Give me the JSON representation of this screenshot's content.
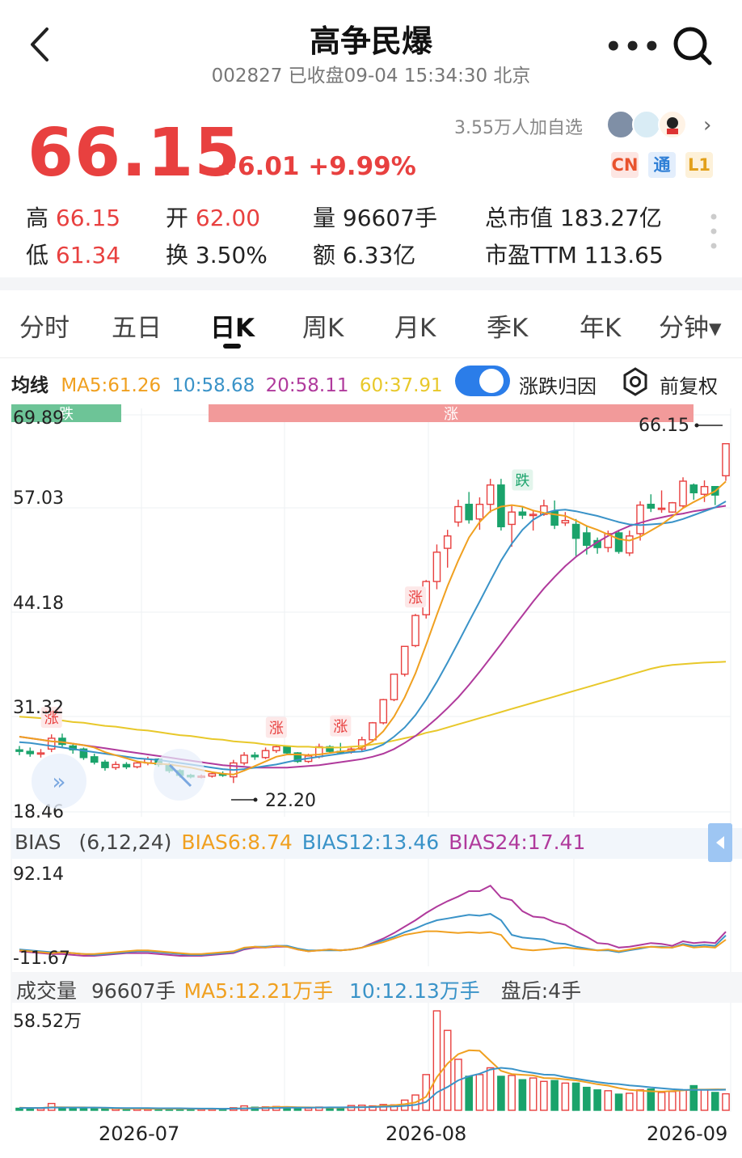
{
  "header": {
    "back_icon": "chevron-left-icon",
    "title": "高争民爆",
    "subtitle": "002827 已收盘09-04 15:34:30 北京",
    "more_icon": "more-dots-icon",
    "search_icon": "search-icon"
  },
  "quote": {
    "price": "66.15",
    "change": "+6.01 +9.99%",
    "followers": "3.55万人加自选",
    "tags": [
      "CN",
      "通",
      "L1"
    ],
    "stats": [
      {
        "label": "高",
        "value": "66.15",
        "red": true
      },
      {
        "label": "开",
        "value": "62.00",
        "red": true
      },
      {
        "label": "量",
        "value": "96607手",
        "red": false
      },
      {
        "label": "总市值",
        "value": "183.27亿",
        "red": false
      },
      {
        "label": "低",
        "value": "61.34",
        "red": true
      },
      {
        "label": "换",
        "value": "3.50%",
        "red": false
      },
      {
        "label": "额",
        "value": "6.33亿",
        "red": false
      },
      {
        "label": "市盈TTM",
        "value": "113.65",
        "red": false
      }
    ]
  },
  "tabs": [
    "分时",
    "五日",
    "日K",
    "周K",
    "月K",
    "季K",
    "年K",
    "分钟▾"
  ],
  "active_tab": "日K",
  "ma_legend": {
    "label": "均线",
    "ma5": "MA5:61.26",
    "ma10": "10:58.68",
    "ma20": "20:58.11",
    "ma60": "60:37.91",
    "toggle_label": "涨跌归因",
    "adjust_label": "前复权"
  },
  "colors": {
    "up": "#e8403f",
    "down": "#1aa36b",
    "ma5": "#f0a020",
    "ma10": "#3a93c8",
    "ma20": "#b03a9c",
    "ma60": "#e8c82a",
    "accent": "#2b7de9"
  },
  "bias_legend": {
    "label": "BIAS",
    "params": "(6,12,24)",
    "b6": "BIAS6:8.74",
    "b12": "BIAS12:13.46",
    "b24": "BIAS24:17.41"
  },
  "volume_legend": {
    "label": "成交量",
    "vol": "96607手",
    "ma5": "MA5:12.21万手",
    "ma10": "10:12.13万手",
    "after_hours": "盘后:4手"
  },
  "dates": [
    "2026-07",
    "2026-08",
    "2026-09"
  ],
  "chart_data": {
    "type": "candlestick",
    "y_ticks": [
      "69.89",
      "57.03",
      "44.18",
      "31.32",
      "18.46"
    ],
    "ylim": [
      18.46,
      69.89
    ],
    "high_marker": "66.15",
    "low_marker": "22.20",
    "event_bands": [
      "跌",
      "涨"
    ],
    "event_labels": [
      "涨",
      "涨",
      "涨",
      "涨",
      "跌"
    ],
    "candles": [
      [
        26.5,
        26.3,
        27.0,
        25.8
      ],
      [
        26.3,
        26.0,
        26.8,
        25.6
      ],
      [
        26.0,
        26.1,
        26.6,
        25.5
      ],
      [
        26.6,
        28.0,
        28.5,
        26.2
      ],
      [
        28.0,
        27.2,
        28.6,
        26.9
      ],
      [
        27.0,
        26.5,
        27.3,
        26.0
      ],
      [
        26.6,
        25.5,
        26.8,
        25.2
      ],
      [
        25.6,
        24.9,
        26.0,
        24.6
      ],
      [
        24.9,
        24.2,
        25.2,
        23.8
      ],
      [
        24.2,
        24.6,
        25.0,
        23.9
      ],
      [
        24.6,
        24.3,
        24.9,
        24.0
      ],
      [
        24.3,
        24.8,
        25.1,
        24.1
      ],
      [
        24.8,
        25.3,
        25.6,
        24.5
      ],
      [
        25.3,
        24.6,
        25.4,
        24.3
      ],
      [
        24.6,
        23.8,
        24.8,
        23.5
      ],
      [
        23.8,
        23.2,
        24.0,
        22.9
      ],
      [
        23.2,
        23.0,
        23.4,
        22.8
      ],
      [
        23.0,
        23.1,
        23.3,
        22.8
      ],
      [
        23.1,
        23.4,
        23.6,
        22.9
      ],
      [
        23.4,
        23.2,
        23.7,
        23.0
      ],
      [
        23.0,
        24.8,
        25.2,
        22.2
      ],
      [
        24.8,
        25.8,
        26.2,
        24.5
      ],
      [
        25.8,
        25.6,
        26.2,
        25.2
      ],
      [
        25.5,
        26.4,
        26.8,
        25.3
      ],
      [
        26.4,
        26.9,
        27.2,
        26.1
      ],
      [
        26.9,
        26.1,
        27.0,
        25.8
      ],
      [
        26.1,
        25.0,
        26.2,
        24.8
      ],
      [
        25.0,
        25.7,
        26.0,
        24.8
      ],
      [
        25.6,
        26.9,
        27.3,
        25.4
      ],
      [
        26.9,
        26.3,
        27.1,
        26.0
      ],
      [
        26.3,
        26.2,
        27.4,
        26.0
      ],
      [
        26.3,
        26.6,
        27.0,
        26.0
      ],
      [
        26.6,
        27.8,
        28.2,
        26.3
      ],
      [
        27.8,
        30.0,
        30.1,
        27.5
      ],
      [
        30.0,
        33.0,
        33.1,
        29.8
      ],
      [
        33.0,
        36.3,
        36.3,
        32.8
      ],
      [
        36.3,
        39.9,
        39.9,
        36.0
      ],
      [
        40.0,
        43.9,
        44.1,
        39.8
      ],
      [
        44.0,
        48.3,
        48.5,
        43.5
      ],
      [
        48.3,
        52.1,
        53.1,
        47.3
      ],
      [
        52.6,
        54.2,
        55.0,
        50.1
      ],
      [
        56.0,
        58.0,
        58.9,
        55.4
      ],
      [
        58.3,
        56.3,
        59.9,
        55.8
      ],
      [
        56.4,
        58.3,
        59.2,
        55.0
      ],
      [
        58.3,
        60.8,
        61.6,
        57.2
      ],
      [
        60.8,
        55.4,
        61.6,
        54.9
      ],
      [
        55.7,
        57.3,
        58.1,
        52.8
      ],
      [
        57.3,
        56.9,
        58.0,
        56.4
      ],
      [
        56.9,
        57.0,
        57.6,
        54.9
      ],
      [
        57.0,
        58.1,
        58.9,
        56.8
      ],
      [
        57.4,
        55.6,
        58.8,
        55.1
      ],
      [
        55.9,
        56.2,
        57.3,
        55.5
      ],
      [
        55.7,
        53.9,
        56.4,
        51.6
      ],
      [
        54.6,
        53.0,
        55.4,
        51.8
      ],
      [
        53.6,
        52.7,
        54.0,
        51.9
      ],
      [
        52.7,
        54.5,
        54.9,
        52.1
      ],
      [
        54.6,
        52.2,
        55.0,
        51.9
      ],
      [
        52.0,
        54.2,
        54.9,
        51.6
      ],
      [
        54.5,
        58.2,
        58.7,
        53.6
      ],
      [
        58.3,
        57.8,
        59.6,
        57.3
      ],
      [
        57.8,
        57.8,
        60.1,
        57.2
      ],
      [
        57.3,
        58.5,
        58.6,
        57.2
      ],
      [
        58.1,
        61.3,
        61.8,
        57.8
      ],
      [
        60.8,
        59.8,
        61.0,
        58.9
      ],
      [
        59.6,
        60.6,
        61.4,
        58.6
      ],
      [
        60.6,
        59.5,
        60.6,
        58.2
      ],
      [
        62.0,
        66.15,
        66.15,
        61.34
      ]
    ],
    "ma5": [
      28.2,
      28.0,
      27.8,
      27.6,
      27.5,
      27.3,
      27.1,
      26.8,
      26.2,
      25.8,
      25.4,
      25.0,
      24.8,
      24.7,
      24.6,
      24.4,
      24.2,
      23.9,
      23.6,
      23.4,
      23.3,
      23.8,
      24.4,
      25.0,
      25.6,
      25.9,
      25.9,
      25.8,
      25.9,
      26.1,
      26.3,
      26.4,
      26.8,
      27.6,
      28.9,
      30.8,
      33.3,
      36.4,
      40.1,
      44.0,
      47.7,
      51.0,
      54.0,
      56.0,
      57.4,
      58.0,
      58.2,
      58.0,
      57.5,
      57.2,
      57.0,
      56.8,
      56.2,
      55.5,
      55.0,
      54.4,
      53.8,
      53.6,
      54.1,
      54.9,
      55.7,
      56.7,
      57.8,
      58.6,
      59.3,
      60.0,
      61.26
    ],
    "ma10": [
      27.5,
      27.4,
      27.2,
      27.0,
      26.8,
      26.6,
      26.4,
      26.2,
      26.0,
      25.8,
      25.6,
      25.4,
      25.3,
      25.2,
      25.0,
      24.8,
      24.6,
      24.4,
      24.2,
      24.0,
      23.9,
      24.0,
      24.2,
      24.4,
      24.6,
      24.9,
      25.2,
      25.4,
      25.6,
      25.8,
      26.0,
      26.2,
      26.3,
      26.6,
      27.2,
      28.2,
      29.4,
      31.0,
      33.0,
      35.3,
      37.8,
      40.4,
      43.1,
      45.7,
      48.4,
      51.0,
      53.2,
      55.0,
      56.3,
      57.1,
      57.5,
      57.6,
      57.4,
      57.1,
      56.8,
      56.4,
      56.0,
      55.7,
      55.6,
      55.7,
      55.8,
      56.0,
      56.4,
      56.9,
      57.4,
      57.9,
      58.68
    ],
    "ma20": [
      28.2,
      28.0,
      27.8,
      27.6,
      27.5,
      27.3,
      27.1,
      26.9,
      26.7,
      26.5,
      26.3,
      26.1,
      25.9,
      25.7,
      25.5,
      25.3,
      25.1,
      24.9,
      24.7,
      24.5,
      24.4,
      24.3,
      24.2,
      24.2,
      24.2,
      24.2,
      24.3,
      24.4,
      24.5,
      24.7,
      24.9,
      25.1,
      25.3,
      25.6,
      26.0,
      26.6,
      27.4,
      28.3,
      29.4,
      30.6,
      31.9,
      33.3,
      34.9,
      36.6,
      38.4,
      40.2,
      42.1,
      43.9,
      45.7,
      47.4,
      48.9,
      50.3,
      51.5,
      52.5,
      53.4,
      54.2,
      54.9,
      55.5,
      55.9,
      56.3,
      56.6,
      56.9,
      57.1,
      57.4,
      57.6,
      57.9,
      58.11
    ],
    "ma60": [
      30.8,
      30.7,
      30.6,
      30.5,
      30.3,
      30.1,
      30.0,
      29.8,
      29.6,
      29.5,
      29.3,
      29.1,
      29.0,
      28.8,
      28.6,
      28.4,
      28.3,
      28.1,
      27.9,
      27.8,
      27.6,
      27.5,
      27.4,
      27.2,
      27.1,
      27.0,
      26.9,
      26.9,
      26.8,
      26.8,
      26.8,
      26.9,
      27.0,
      27.2,
      27.4,
      27.7,
      28.0,
      28.3,
      28.7,
      29.0,
      29.4,
      29.8,
      30.2,
      30.6,
      31.0,
      31.4,
      31.8,
      32.2,
      32.6,
      33.0,
      33.4,
      33.8,
      34.2,
      34.6,
      35.0,
      35.4,
      35.8,
      36.2,
      36.6,
      37.0,
      37.3,
      37.5,
      37.6,
      37.7,
      37.8,
      37.85,
      37.91
    ],
    "bias": {
      "ylim": [
        -11.67,
        92.14
      ],
      "y_ticks": [
        "92.14",
        "-11.67"
      ],
      "bias6": [
        -3,
        -4,
        -5,
        -6,
        -5,
        -6,
        -7,
        -7,
        -6,
        -5,
        -4,
        -3,
        -3,
        -4,
        -5,
        -6,
        -7,
        -7,
        -6,
        -5,
        -4,
        0,
        1,
        0,
        2,
        1,
        -2,
        -4,
        -3,
        -2,
        -3,
        -2,
        0,
        3,
        6,
        10,
        14,
        16,
        18,
        18,
        17,
        16,
        17,
        16,
        17,
        14,
        0,
        -2,
        -3,
        -2,
        -1,
        0,
        -1,
        -2,
        -3,
        -2,
        -4,
        -2,
        0,
        1,
        0,
        0,
        3,
        0,
        1,
        0,
        8.74
      ],
      "bias12": [
        -2,
        -3,
        -4,
        -5,
        -5,
        -6,
        -7,
        -8,
        -7,
        -6,
        -5,
        -4,
        -4,
        -5,
        -6,
        -7,
        -8,
        -8,
        -7,
        -6,
        -5,
        -1,
        1,
        1,
        2,
        2,
        -1,
        -3,
        -3,
        -3,
        -3,
        -2,
        0,
        4,
        8,
        12,
        17,
        21,
        26,
        30,
        32,
        34,
        36,
        35,
        37,
        30,
        14,
        11,
        10,
        9,
        5,
        4,
        1,
        -1,
        -3,
        -3,
        -5,
        -3,
        -1,
        1,
        1,
        0,
        4,
        2,
        3,
        2,
        13.46
      ],
      "bias24": [
        -4,
        -5,
        -6,
        -7,
        -7,
        -8,
        -9,
        -9,
        -8,
        -7,
        -6,
        -6,
        -6,
        -7,
        -8,
        -9,
        -9,
        -9,
        -8,
        -7,
        -6,
        -2,
        0,
        0,
        1,
        1,
        -2,
        -4,
        -3,
        -2,
        -3,
        -2,
        0,
        5,
        10,
        16,
        23,
        30,
        38,
        45,
        51,
        56,
        62,
        62,
        68,
        55,
        52,
        40,
        34,
        33,
        28,
        25,
        18,
        12,
        5,
        4,
        0,
        1,
        3,
        5,
        4,
        2,
        7,
        5,
        6,
        5,
        17.41
      ]
    },
    "volume": {
      "ylim": [
        0,
        58.52
      ],
      "y_ticks": [
        "58.52万"
      ],
      "values": [
        1.2,
        1.0,
        1.1,
        4.0,
        1.5,
        1.2,
        1.3,
        1.0,
        0.9,
        1.0,
        0.8,
        1.1,
        1.0,
        0.9,
        0.8,
        0.9,
        0.8,
        0.8,
        1.0,
        0.9,
        1.5,
        2.6,
        1.8,
        2.0,
        2.2,
        1.5,
        1.3,
        1.2,
        1.9,
        1.4,
        1.3,
        2.8,
        3.0,
        2.6,
        3.4,
        3.2,
        6.0,
        9.0,
        21.0,
        58.5,
        47.0,
        30.0,
        20.0,
        21.0,
        25.0,
        20.0,
        20.5,
        18.0,
        19.0,
        17.0,
        17.5,
        16.0,
        16.0,
        13.5,
        12.0,
        11.5,
        9.5,
        10.0,
        12.0,
        12.5,
        10.5,
        11.0,
        12.0,
        14.5,
        12.0,
        10.5,
        9.7
      ],
      "ma5": [
        1.5,
        1.4,
        1.4,
        1.8,
        1.8,
        1.7,
        1.7,
        1.6,
        1.4,
        1.1,
        1.0,
        1.0,
        0.9,
        0.9,
        0.9,
        0.9,
        0.9,
        0.9,
        0.9,
        0.9,
        1.0,
        1.2,
        1.4,
        1.6,
        1.9,
        2.0,
        1.8,
        1.7,
        1.6,
        1.5,
        1.5,
        1.7,
        1.9,
        2.1,
        2.6,
        3.0,
        3.6,
        4.6,
        8.0,
        19.5,
        27.5,
        33.0,
        35.3,
        35.0,
        29.0,
        23.2,
        21.3,
        20.9,
        20.5,
        19.0,
        18.8,
        18.2,
        17.6,
        16.5,
        15.3,
        14.5,
        13.1,
        12.0,
        11.5,
        11.2,
        11.0,
        11.3,
        11.7,
        12.2,
        12.2,
        12.3,
        12.21
      ],
      "ma10": [
        1.4,
        1.4,
        1.4,
        1.6,
        1.6,
        1.6,
        1.6,
        1.6,
        1.5,
        1.4,
        1.3,
        1.3,
        1.3,
        1.2,
        1.2,
        1.2,
        1.1,
        1.0,
        1.0,
        0.9,
        1.0,
        1.1,
        1.2,
        1.3,
        1.4,
        1.5,
        1.5,
        1.5,
        1.6,
        1.7,
        1.7,
        1.8,
        1.8,
        1.9,
        2.1,
        2.3,
        2.6,
        3.2,
        4.9,
        10.5,
        13.7,
        17.6,
        20.0,
        21.5,
        24.0,
        25.0,
        24.4,
        23.0,
        22.0,
        21.0,
        20.8,
        19.5,
        18.6,
        17.6,
        16.6,
        15.8,
        15.4,
        14.6,
        14.2,
        13.5,
        13.0,
        12.4,
        12.1,
        12.0,
        12.0,
        12.0,
        12.13
      ]
    }
  }
}
